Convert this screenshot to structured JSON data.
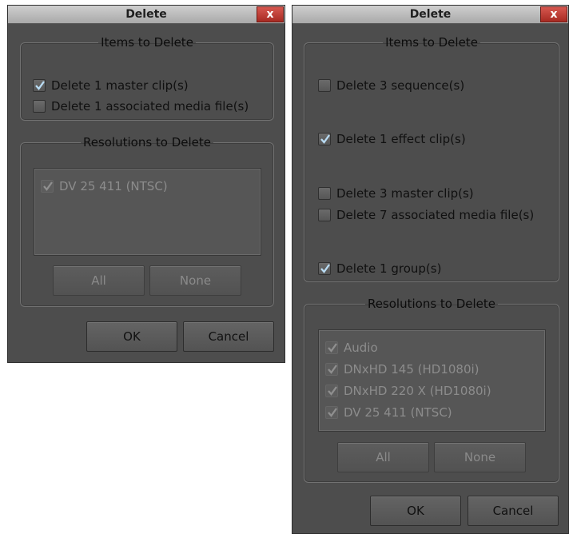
{
  "dialog_left": {
    "title": "Delete",
    "close_label": "x",
    "items_group": {
      "legend": "Items to Delete",
      "items": [
        {
          "label": "Delete 1 master clip(s)",
          "checked": true
        },
        {
          "label": "Delete 1 associated media file(s)",
          "checked": false
        }
      ]
    },
    "resolutions_group": {
      "legend": "Resolutions to Delete",
      "items": [
        {
          "label": "DV 25 411 (NTSC)",
          "checked": true,
          "disabled": true
        }
      ],
      "all_label": "All",
      "none_label": "None"
    },
    "ok_label": "OK",
    "cancel_label": "Cancel"
  },
  "dialog_right": {
    "title": "Delete",
    "close_label": "x",
    "items_group": {
      "legend": "Items to Delete",
      "items": [
        {
          "label": "Delete 3 sequence(s)",
          "checked": false
        },
        {
          "label": "Delete 1 effect clip(s)",
          "checked": true
        },
        {
          "label": "Delete 3 master clip(s)",
          "checked": false
        },
        {
          "label": "Delete 7 associated media file(s)",
          "checked": false
        },
        {
          "label": "Delete 1 group(s)",
          "checked": true
        }
      ]
    },
    "resolutions_group": {
      "legend": "Resolutions to Delete",
      "items": [
        {
          "label": "Audio",
          "checked": true,
          "disabled": true
        },
        {
          "label": "DNxHD 145 (HD1080i)",
          "checked": true,
          "disabled": true
        },
        {
          "label": "DNxHD 220 X (HD1080i)",
          "checked": true,
          "disabled": true
        },
        {
          "label": "DV 25 411 (NTSC)",
          "checked": true,
          "disabled": true
        }
      ],
      "all_label": "All",
      "none_label": "None"
    },
    "ok_label": "OK",
    "cancel_label": "Cancel"
  },
  "colors": {
    "dialog_bg": "#4d4d4d",
    "check_enabled": "#b9dcf4",
    "check_disabled": "#8f8f8f",
    "close_red": "#c23a31"
  }
}
